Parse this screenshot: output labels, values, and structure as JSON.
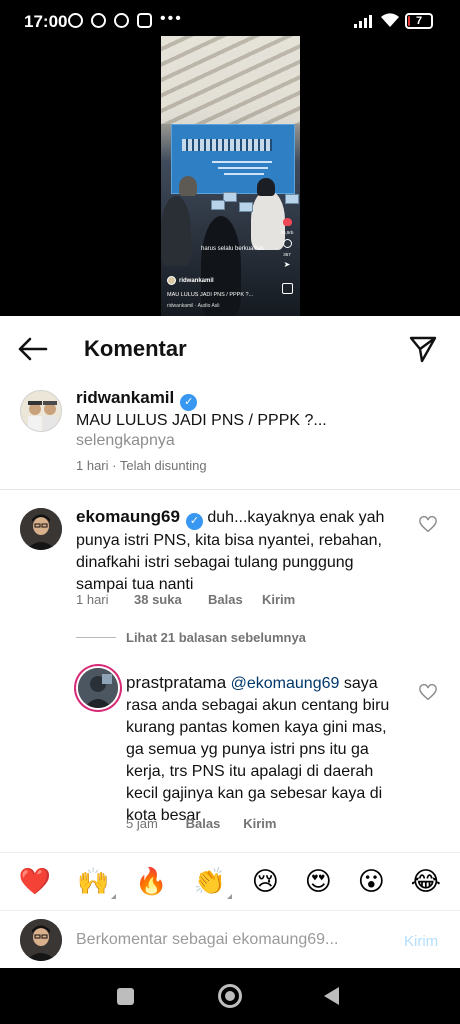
{
  "status_bar": {
    "time": "17:00",
    "battery": "7",
    "battery_level": 0.07
  },
  "video": {
    "caption_overlay": "harus selalu berkualitas",
    "author": "ridwankamil",
    "title": "MAU LULUS JADI PNS / PPPK ?...",
    "audio": "ridwankamil · Audio Asli",
    "likes": "25,9rb",
    "comments": "367"
  },
  "header": {
    "title": "Komentar"
  },
  "post": {
    "username": "ridwankamil",
    "text": "MAU LULUS JADI PNS / PPPK ?...",
    "more": "selengkapnya",
    "meta": "1 hari · Telah disunting"
  },
  "comment": {
    "username": "ekomaung69",
    "text": " duh...kayaknya enak yah punya istri PNS, kita bisa nyantei, rebahan, dinafkahi istri sebagai tulang punggung sampai tua nanti",
    "time": "1 hari",
    "likes": "38 suka",
    "reply": "Balas",
    "send": "Kirim"
  },
  "view_replies": {
    "label": "Lihat 21 balasan sebelumnya"
  },
  "reply": {
    "username": "prastpratama",
    "mention": "@ekomaung69",
    "text": " saya rasa anda sebagai akun centang biru kurang pantas komen kaya gini mas, ga semua yg punya istri pns itu ga kerja, trs PNS itu apalagi di daerah kecil gajinya kan ga sebesar kaya di kota besar",
    "time": "5 jam",
    "reply": "Balas",
    "send": "Kirim"
  },
  "emojis": [
    "❤️",
    "🙌",
    "🔥",
    "👏",
    "😢",
    "😍",
    "😮",
    "😂"
  ],
  "input": {
    "placeholder": "Berkomentar sebagai ekomaung69...",
    "post": "Kirim"
  }
}
